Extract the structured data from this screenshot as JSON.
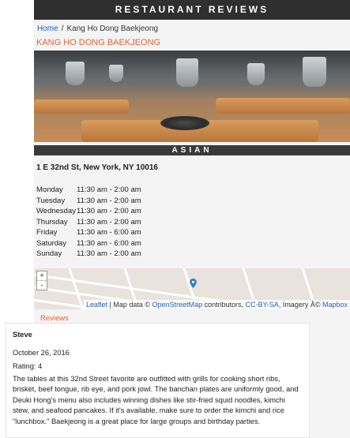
{
  "header": {
    "title": "RESTAURANT REVIEWS"
  },
  "breadcrumb": {
    "home": "Home",
    "separator": "/",
    "current": "Kang Ho Dong Baekjeong"
  },
  "restaurant": {
    "name": "KANG HO DONG BAEKJEONG",
    "category": "ASIAN",
    "address": "1 E 32nd St, New York, NY 10016",
    "hours": [
      {
        "day": "Monday",
        "time": "11:30 am - 2:00 am"
      },
      {
        "day": "Tuesday",
        "time": "11:30 am - 2:00 am"
      },
      {
        "day": "Wednesday",
        "time": "11:30 am - 2:00 am"
      },
      {
        "day": "Thursday",
        "time": "11:30 am - 2:00 am"
      },
      {
        "day": "Friday",
        "time": "11:30 am - 6:00 am"
      },
      {
        "day": "Saturday",
        "time": "11:30 am - 6:00 am"
      },
      {
        "day": "Sunday",
        "time": "11:30 am - 2:00 am"
      }
    ]
  },
  "map": {
    "zoom_in": "+",
    "zoom_out": "-",
    "attribution": {
      "leaflet": "Leaflet",
      "sep1": " | Map data © ",
      "osm": "OpenStreetMap",
      "sep2": " contributors, ",
      "license": "CC-BY-SA",
      "sep3": ", Imagery Â© ",
      "mapbox": "Mapbox"
    }
  },
  "reviews": {
    "label": "Reviews",
    "items": [
      {
        "author": "Steve",
        "date": "October 26, 2016",
        "rating": "Rating: 4",
        "text": "The tables at this 32nd Street favorite are outfitted with grills for cooking short ribs, brisket, beef tongue, rib eye, and pork jowl. The banchan plates are uniformly good, and Deuki Hong's menu also includes winning dishes like stir-fried squid noodles, kimchi stew, and seafood pancakes. If it's available, make sure to order the kimchi and rice \"lunchbox.\" Baekjeong is a great place for large groups and birthday parties."
      }
    ]
  },
  "colors": {
    "accent": "#e0643a",
    "link": "#1f5fbf",
    "header_bg": "#2f2f2f"
  }
}
